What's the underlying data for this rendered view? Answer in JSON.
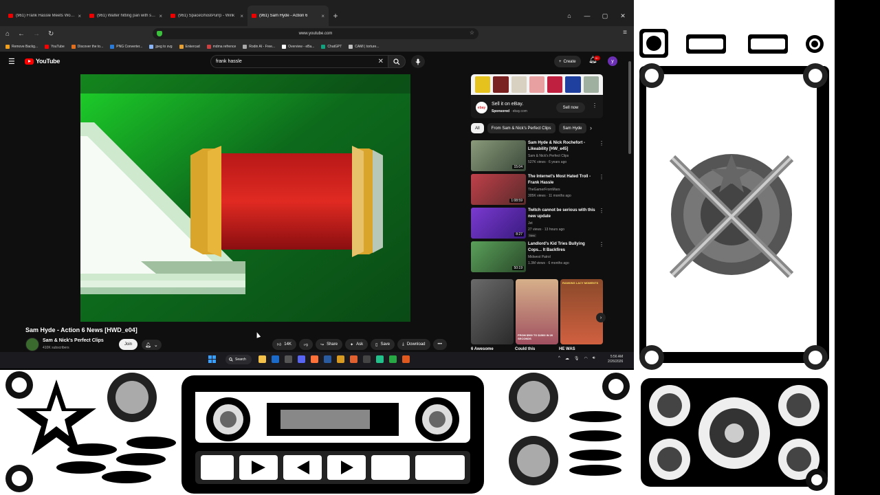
{
  "browser": {
    "tabs": [
      {
        "label": "(961) Frank Hassle Meets WorldOf",
        "active": false
      },
      {
        "label": "(961) Walter hitting pan with spoo",
        "active": false
      },
      {
        "label": "(961) SpaceGhostPurrp - Wink",
        "active": false
      },
      {
        "label": "(961) Sam Hyde - Action 6",
        "active": true
      }
    ],
    "url": "www.youtube.com",
    "bookmarks": [
      {
        "label": "Remove Backg...",
        "color": "#f0a020"
      },
      {
        "label": "YouTube",
        "color": "#ff0000"
      },
      {
        "label": "Discover the to...",
        "color": "#e07020"
      },
      {
        "label": "PNG Converter...",
        "color": "#2a7ad8"
      },
      {
        "label": "jpeg to svg",
        "color": "#8ab4f8"
      },
      {
        "label": "Enkercad",
        "color": "#e8a030"
      },
      {
        "label": "mdma refrence",
        "color": "#d04040"
      },
      {
        "label": "Rodin AI - Free...",
        "color": "#aaaaaa"
      },
      {
        "label": "Overview - eBa...",
        "color": "#ffffff"
      },
      {
        "label": "ChatGPT",
        "color": "#10a37f"
      },
      {
        "label": "CAMI | torture...",
        "color": "#c0c0c0"
      }
    ]
  },
  "youtube": {
    "logo": "YouTube",
    "search_value": "frank hassle",
    "create_label": "Create",
    "notif_count": "9+",
    "avatar_letter": "y",
    "video": {
      "title": "Sam Hyde - Action 6 News [HWD_e04]",
      "channel": "Sam & Nick's Perfect Clips",
      "subscribers": "410K subscribers",
      "join_label": "Join",
      "likes": "14K",
      "share_label": "Share",
      "ask_label": "Ask",
      "save_label": "Save",
      "download_label": "Download"
    },
    "ad": {
      "title": "Sell it on eBay.",
      "sponsored": "Sponsored",
      "domain": "ebay.com",
      "button": "Sell now",
      "logo": "ebay"
    },
    "chips": [
      "All",
      "From Sam & Nick's Perfect Clips",
      "Sam Hyde"
    ],
    "recommendations": [
      {
        "title": "Sam Hyde & Nick Rochefort - Likeability [HW_e45]",
        "channel": "Sam & Nick's Perfect Clips",
        "meta": "527K views · 6 years ago",
        "duration": "15:04",
        "badge": ""
      },
      {
        "title": "The Internet's Most Hated Troll - Frank Hassle",
        "channel": "TheGamerFromMars",
        "meta": "305K views · 11 months ago",
        "duration": "1:08:59",
        "badge": ""
      },
      {
        "title": "Twitch cannot be serious with this new update",
        "channel": "Jet",
        "meta": "27 views · 13 hours ago",
        "duration": "8:27",
        "badge": "New"
      },
      {
        "title": "Landlord's Kid Tries Bullying Cops... It Backfires",
        "channel": "Midwest Patrol",
        "meta": "1.3M views · 6 months ago",
        "duration": "50:19",
        "badge": ""
      }
    ],
    "shorts": [
      {
        "title": "6 Awesome",
        "caption": ""
      },
      {
        "title": "Could this",
        "caption": "FROM $500 TO $1500 IN 20 SECONDS"
      },
      {
        "title": "HE WAS",
        "caption": "RANKING LACY MOMENTS"
      }
    ]
  },
  "taskbar": {
    "search_label": "Search",
    "time": "5:56 AM",
    "date": "2/26/2026"
  }
}
